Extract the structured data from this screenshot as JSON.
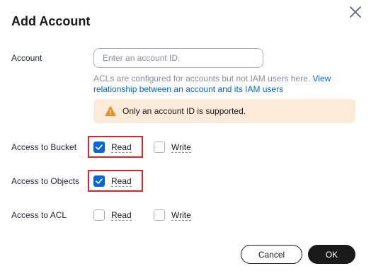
{
  "dialog": {
    "title": "Add Account",
    "close_icon": "close-icon"
  },
  "account": {
    "label": "Account",
    "placeholder": "Enter an account ID.",
    "value": "",
    "help_text": "ACLs are configured for accounts but not IAM users here. ",
    "help_link": "View relationship between an account and its IAM users",
    "alert_icon": "warning-icon",
    "alert_text": "Only an account ID is supported."
  },
  "permissions": {
    "bucket": {
      "label": "Access to Bucket",
      "read": {
        "label": "Read",
        "checked": true
      },
      "write": {
        "label": "Write",
        "checked": false
      }
    },
    "objects": {
      "label": "Access to Objects",
      "read": {
        "label": "Read",
        "checked": true
      }
    },
    "acl": {
      "label": "Access to ACL",
      "read": {
        "label": "Read",
        "checked": false
      },
      "write": {
        "label": "Write",
        "checked": false
      }
    }
  },
  "footer": {
    "cancel_label": "Cancel",
    "ok_label": "OK"
  },
  "colors": {
    "accent": "#0066d9",
    "highlight": "#e3222a",
    "warning": "#f08a17",
    "alert_bg": "#fdebd9"
  }
}
